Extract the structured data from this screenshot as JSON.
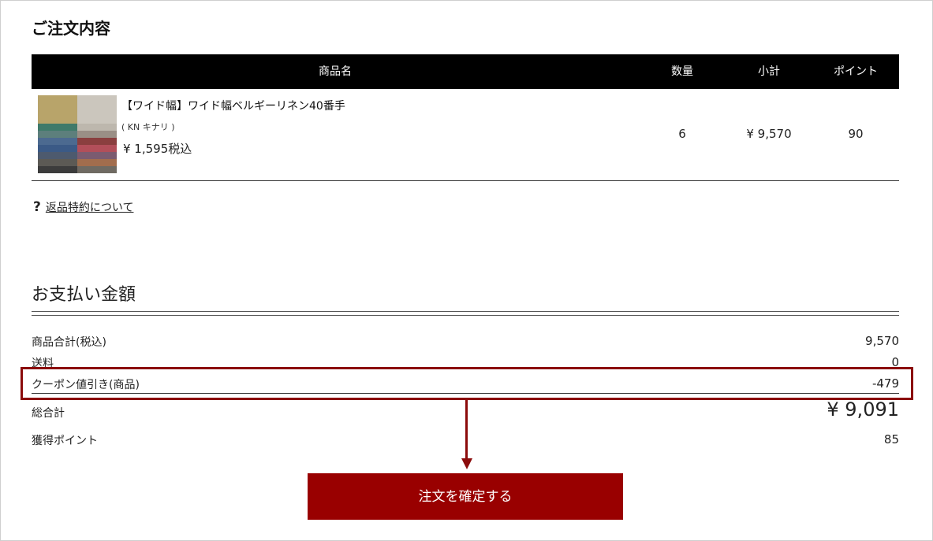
{
  "order": {
    "title": "ご注文内容",
    "table_headers": [
      "商品名",
      "数量",
      "小計",
      "ポイント"
    ],
    "items": [
      {
        "name": "【ワイド幅】ワイド幅ベルギーリネン40番手",
        "variant": "( KN キナリ )",
        "price": "¥ 1,595税込",
        "quantity": "6",
        "subtotal": "¥ 9,570",
        "points": "90"
      }
    ],
    "returns_question": "?",
    "returns_link": "返品特約について"
  },
  "payment": {
    "title": "お支払い金額",
    "lines": [
      {
        "label": "商品合計(税込)",
        "value": "9,570"
      },
      {
        "label": "送料",
        "value": "0"
      },
      {
        "label": "クーポン値引き(商品)",
        "value": "-479"
      }
    ],
    "total_label": "総合計",
    "total_value": "¥ 9,091",
    "points_label": "獲得ポイント",
    "points_value": "85"
  },
  "confirm_button": "注文を確定する",
  "colors": {
    "accent": "#990000",
    "highlight_box": "#8b0b0b",
    "header_bg": "#000000"
  }
}
